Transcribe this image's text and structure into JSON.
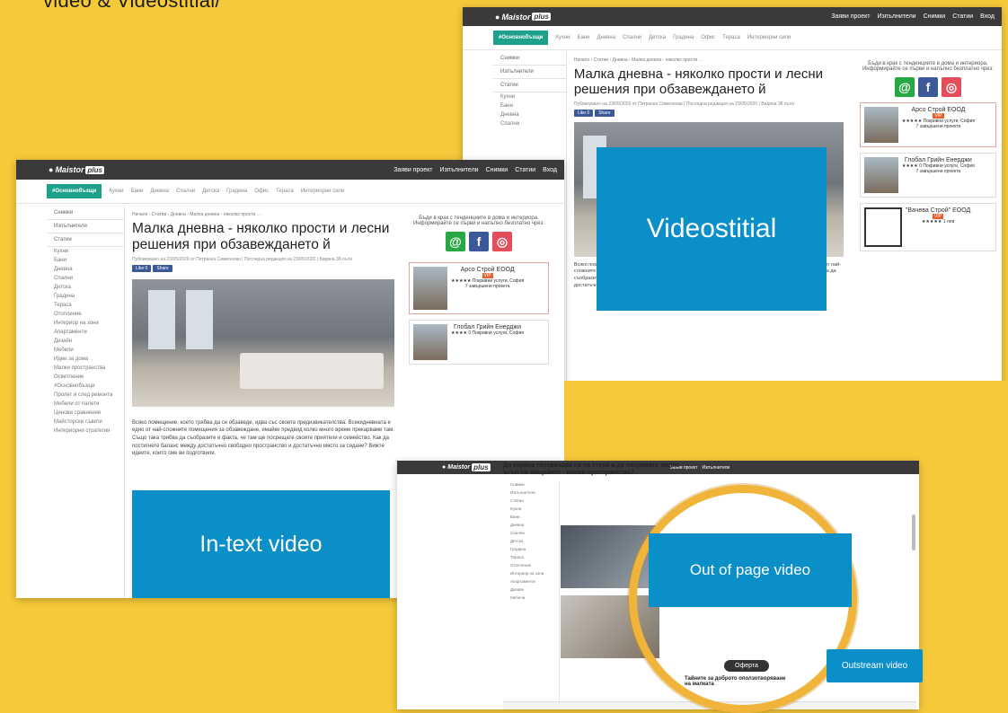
{
  "heading_fragment": "video & Videostitial/",
  "site": {
    "logo_main": "Maistor",
    "logo_plus": "plus",
    "nav": [
      "Заяви проект",
      "Изпълнители",
      "Снимки",
      "Статии",
      "Вход"
    ],
    "home_label": "#Основнобъзщи",
    "categories": [
      "Кухни",
      "Бани",
      "Дневна",
      "Спални",
      "Детска",
      "Градина",
      "Офис",
      "Тераса",
      "Интериорни сили"
    ]
  },
  "sidebar": {
    "blocks": [
      "Снимки",
      "Изпълнители",
      "Статии"
    ],
    "items": [
      "Кухни",
      "Бани",
      "Дневна",
      "Спални",
      "Детска",
      "Градина",
      "Тераса",
      "Отопление",
      "Интериор на зони",
      "Апартаменти",
      "Дизайн",
      "Мебели",
      "Идеи за дома",
      "Малки пространства",
      "Осветление",
      "#Основнобъзщи",
      "Пролет и след ремонта",
      "Мебели от палети",
      "Ценови сравнения",
      "Майсторски съвети",
      "Интериорни стратегии"
    ]
  },
  "article": {
    "breadcrumb": "Начало › Статии › Дневна › Малка дневна - няколко прости ...",
    "title": "Малка дневна - няколко прости и лесни решения при обзавеждането й",
    "meta": "Публикувано на 23/05/2020 от Петранка Симеонова | Последна редакция на 23/05/2020 | Видяна 38 пъти",
    "like": "Like 0",
    "share": "Share",
    "body": "Всяко помещение, което трябва да се обзаведе, идва със своите предизвикателства. Всекидневната е едно от най-сложните помещения за обзавеждане, имайки предвид колко много време прекарваме там. Също така трябва да съобразите и факта, че там ще посрещате своите приятели и семейство. Как да постигнете баланс между достатъчно свободно пространство и достатъчно място за сядане? Вижте идеите, които сме ви подготвили."
  },
  "right_sidebar": {
    "blurb": "Бъди в крак с тенденциите в дома и интериора. Информирайте се първи и напълно безплатно чрез:",
    "social": [
      "@",
      "f",
      "◎"
    ],
    "companies": [
      {
        "name": "Арсо Строй ЕООД",
        "badge": "VIP",
        "rating": "★★★★★ Покривни услуги, София",
        "projects": "7 завършени проекта"
      },
      {
        "name": "Глобал Грийн Енерджи",
        "badge": "",
        "rating": "★★★★ 0 Покривни услуги, София",
        "projects": "7 завършени проекта"
      },
      {
        "name": "\"Вачева Строй\" ЕООД",
        "badge": "VIP",
        "rating": "★★★★★ 1 лев",
        "projects": ""
      }
    ]
  },
  "third": {
    "title": "До екрана телевизора си на стена и да направите малко ъгъл на мащабите - малки пространства?",
    "bottom_title": "Тайните за доброто оползотворяване на малката",
    "bottom_button": "Оферта"
  },
  "labels": {
    "videostitial": "Videostitial",
    "intext": "In-text video",
    "outofpage": "Out of page video",
    "outstream": "Outstream video"
  },
  "colors": {
    "background": "#f5c93a",
    "blue": "#0b8fc9",
    "ring": "#f0b43a",
    "topbar": "#3a3a3a",
    "accent_green": "#1ea18b"
  }
}
